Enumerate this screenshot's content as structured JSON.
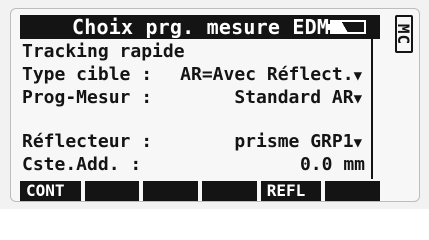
{
  "screen": {
    "title": "Choix prg. mesure EDM",
    "mode_badge": "MC",
    "battery_icon": "battery-icon"
  },
  "rows": {
    "tracking": "Tracking rapide",
    "type_cible_label": "Type cible :",
    "type_cible_value": "AR=Avec Réflect.",
    "prog_mesur_label": "Prog-Mesur :",
    "prog_mesur_value": "Standard AR",
    "reflecteur_label": "Réflecteur :",
    "reflecteur_value": "prisme GRP1",
    "cste_add_label": "Cste.Add.  :",
    "cste_add_value": "0.0 mm"
  },
  "softkeys": {
    "f1": "CONT",
    "f2": "",
    "f3": "",
    "f4": "",
    "f5": "REFL",
    "f6": ""
  },
  "colors": {
    "lcd_background": "#f7f7f7",
    "ink": "#141414"
  }
}
